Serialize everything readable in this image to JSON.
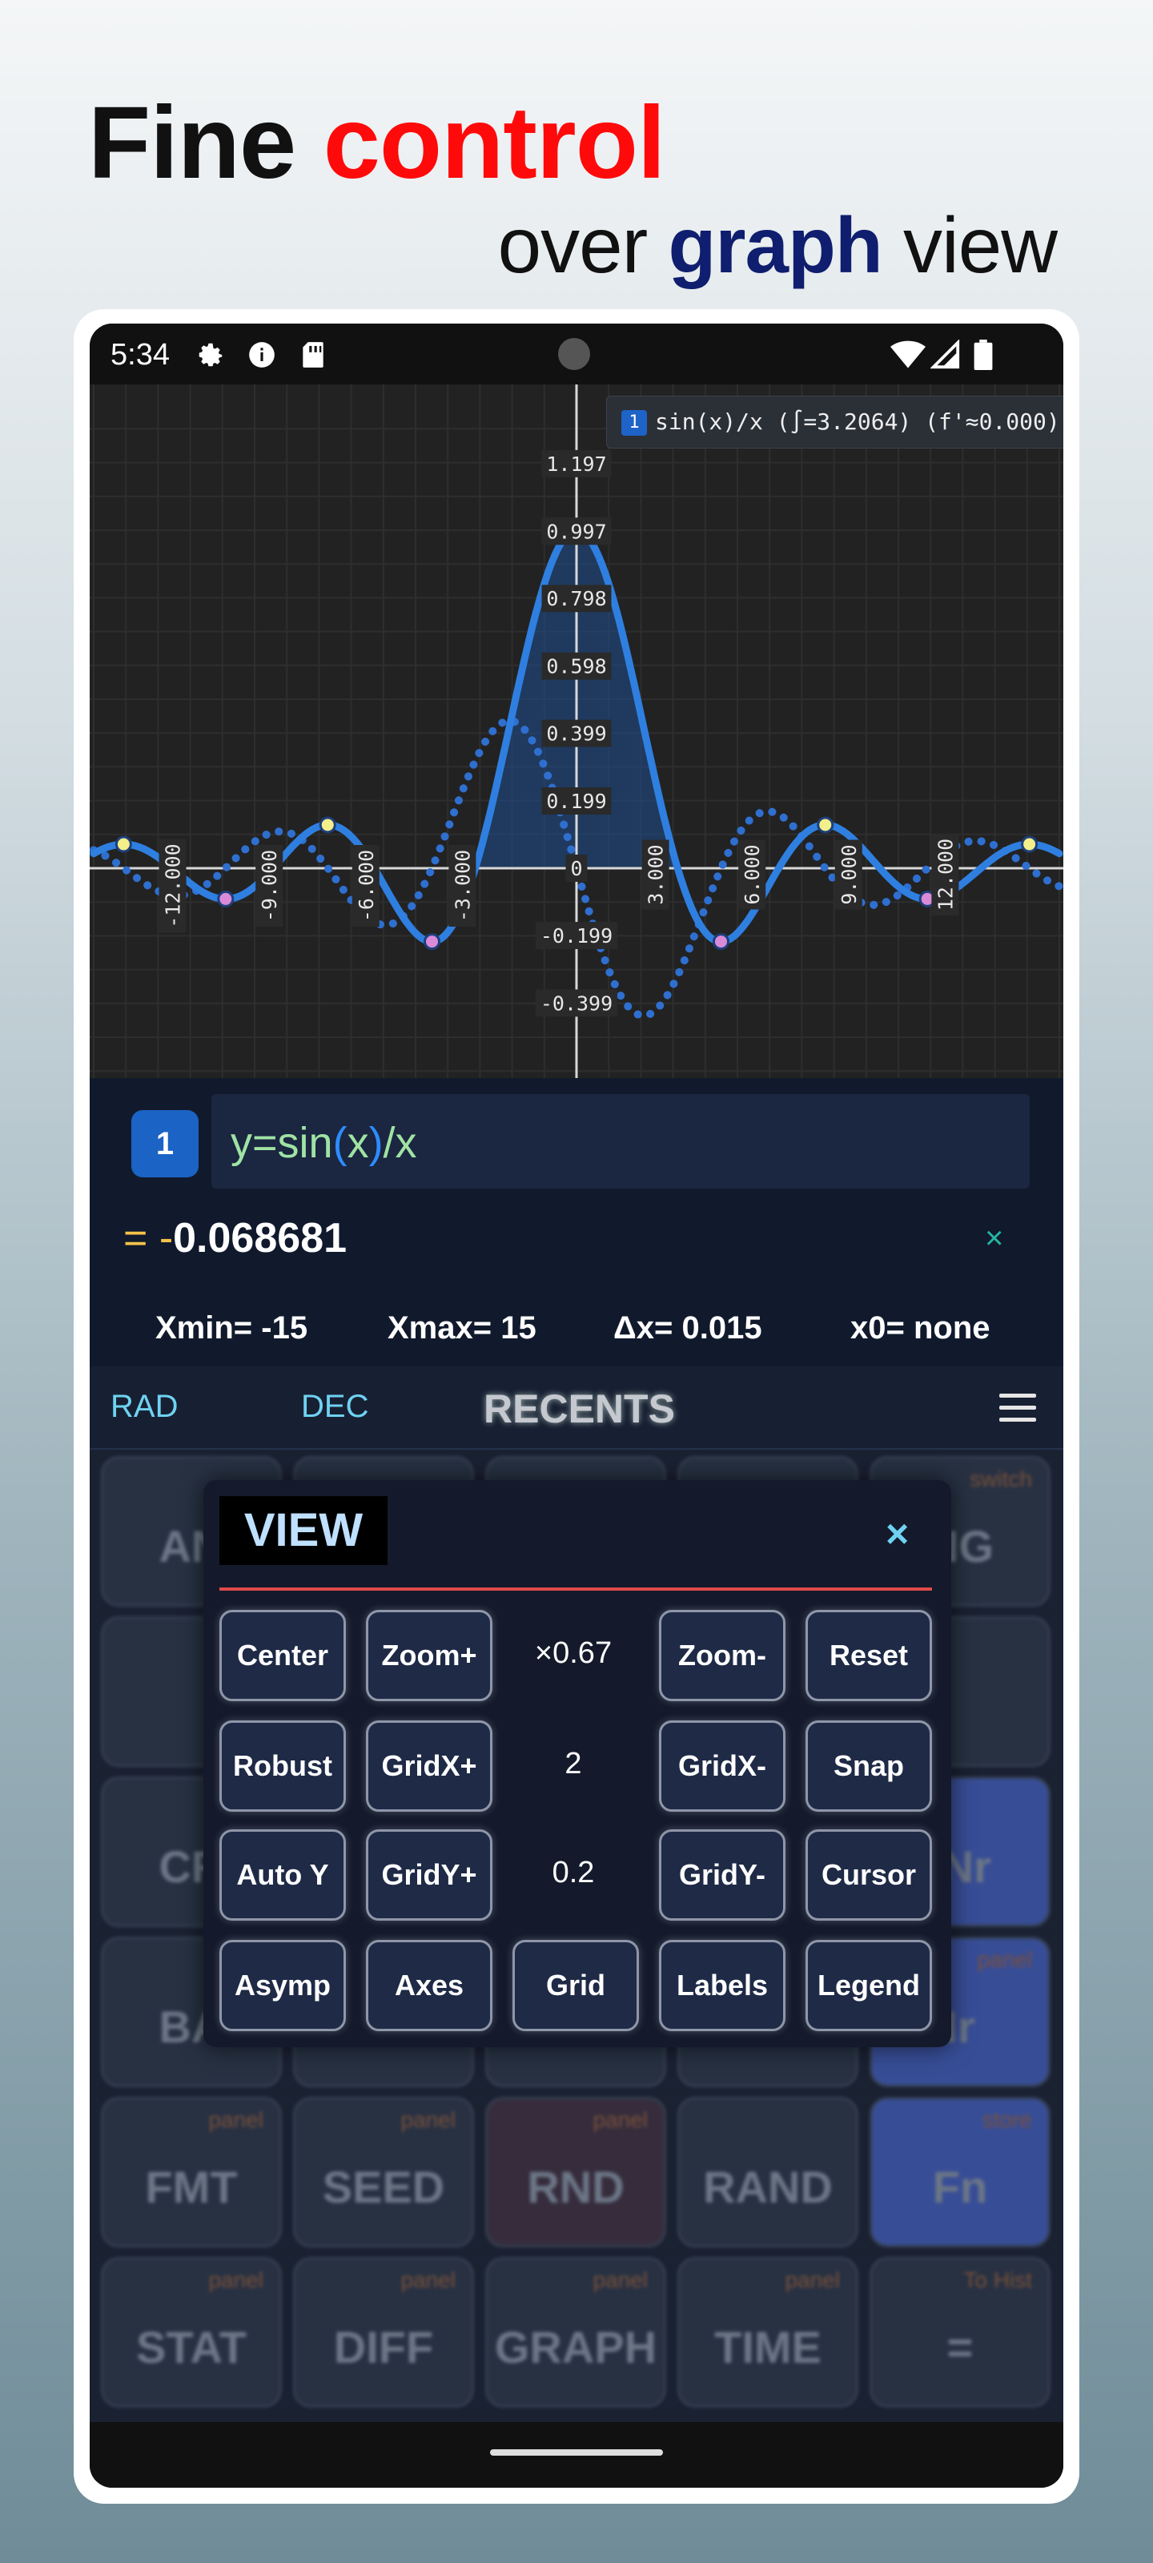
{
  "headline": {
    "line1_plain": "Fine ",
    "line1_accent": "control",
    "line2_plain_a": "over ",
    "line2_accent": "graph",
    "line2_plain_b": " view",
    "colors": {
      "accent_red": "#ff0a0a",
      "accent_navy": "#0f1e6e"
    }
  },
  "status_bar": {
    "time": "5:34",
    "left_icons": [
      "gear-icon",
      "info-icon",
      "sd-card-icon"
    ],
    "right_icons": [
      "wifi-icon",
      "cell-signal-icon",
      "battery-icon"
    ]
  },
  "graph": {
    "legend_index": "1",
    "legend_text": "sin(x)/x (∫=3.2064) (f'≈0.000)"
  },
  "chart_data": {
    "type": "line",
    "xlim": [
      -15,
      15
    ],
    "ylim": [
      -0.63,
      1.4
    ],
    "x_tick_labels": [
      "-12.000",
      "-9.000",
      "-6.000",
      "-3.000",
      "3.000",
      "6.000",
      "9.000",
      "12.000"
    ],
    "x_ticks": [
      -12,
      -9,
      -6,
      -3,
      3,
      6,
      9,
      12
    ],
    "y_tick_labels": [
      "1.197",
      "0.997",
      "0.798",
      "0.598",
      "0.399",
      "0.199",
      "0",
      "-0.199",
      "-0.399"
    ],
    "y_ticks": [
      1.197,
      0.997,
      0.798,
      0.598,
      0.399,
      0.199,
      0,
      -0.199,
      -0.399
    ],
    "series": [
      {
        "function": "sin(x)/x",
        "style": "solid",
        "color": "#2f7fe0",
        "area_shaded_between": [
          -3.1416,
          3.1416
        ]
      },
      {
        "function": "cos(x)/x - sin(x)/x^2",
        "style": "dotted",
        "color": "#2f6fcf"
      }
    ],
    "maxima_points": [
      [
        -14.07,
        0.071
      ],
      [
        -7.73,
        0.128
      ],
      [
        7.73,
        0.128
      ],
      [
        14.07,
        0.071
      ]
    ],
    "minima_points": [
      [
        -10.9,
        -0.091
      ],
      [
        -4.49,
        -0.217
      ],
      [
        4.49,
        -0.217
      ],
      [
        10.9,
        -0.091
      ]
    ],
    "grid": true
  },
  "expression": {
    "index": "1",
    "lhs": "y=sin",
    "open_paren": "(",
    "arg": "x",
    "close_paren": ")",
    "rhs": "/x",
    "result_eq": "= -",
    "result_value": "0.068681",
    "clear_label": "×"
  },
  "range": {
    "xmin": "Xmin= -15",
    "xmax": "Xmax= 15",
    "dx": "Δx= 0.015",
    "x0": "x0= none"
  },
  "mode_bar": {
    "angle_mode": "RAD",
    "base_mode": "DEC",
    "recents": "RECENTS"
  },
  "background_keys": [
    {
      "label": "AN",
      "sub": ""
    },
    {
      "label": "",
      "sub": ""
    },
    {
      "label": "",
      "sub": ""
    },
    {
      "label": "",
      "sub": ""
    },
    {
      "label": "NG",
      "sub": "switch"
    },
    {
      "label": "",
      "sub": ""
    },
    {
      "label": "",
      "sub": ""
    },
    {
      "label": "",
      "sub": ""
    },
    {
      "label": "",
      "sub": ""
    },
    {
      "label": "",
      "sub": ""
    },
    {
      "label": "CR",
      "sub": ""
    },
    {
      "label": "",
      "sub": ""
    },
    {
      "label": "",
      "sub": ""
    },
    {
      "label": "",
      "sub": ""
    },
    {
      "label": "/Nr",
      "sub": ""
    },
    {
      "label": "BA",
      "sub": ""
    },
    {
      "label": "",
      "sub": ""
    },
    {
      "label": "",
      "sub": ""
    },
    {
      "label": "",
      "sub": ""
    },
    {
      "label": "Ir",
      "sub": "panel"
    },
    {
      "label": "FMT",
      "sub": "panel"
    },
    {
      "label": "SEED",
      "sub": "panel"
    },
    {
      "label": "RND",
      "sub": "panel"
    },
    {
      "label": "RAND",
      "sub": ""
    },
    {
      "label": "Fn",
      "sub": "store"
    },
    {
      "label": "STAT",
      "sub": "panel"
    },
    {
      "label": "DIFF",
      "sub": "panel"
    },
    {
      "label": "GRAPH",
      "sub": "panel"
    },
    {
      "label": "TIME",
      "sub": "panel"
    },
    {
      "label": "=",
      "sub": "To Hist"
    }
  ],
  "view_dialog": {
    "title": "VIEW",
    "close": "×",
    "rows": [
      [
        "Center",
        "Zoom+",
        "×0.67",
        "Zoom-",
        "Reset"
      ],
      [
        "Robust",
        "GridX+",
        "2",
        "GridX-",
        "Snap"
      ],
      [
        "Auto Y",
        "GridY+",
        "0.2",
        "GridY-",
        "Cursor"
      ],
      [
        "Asymp",
        "Axes",
        "Grid",
        "Labels",
        "Legend"
      ]
    ]
  }
}
